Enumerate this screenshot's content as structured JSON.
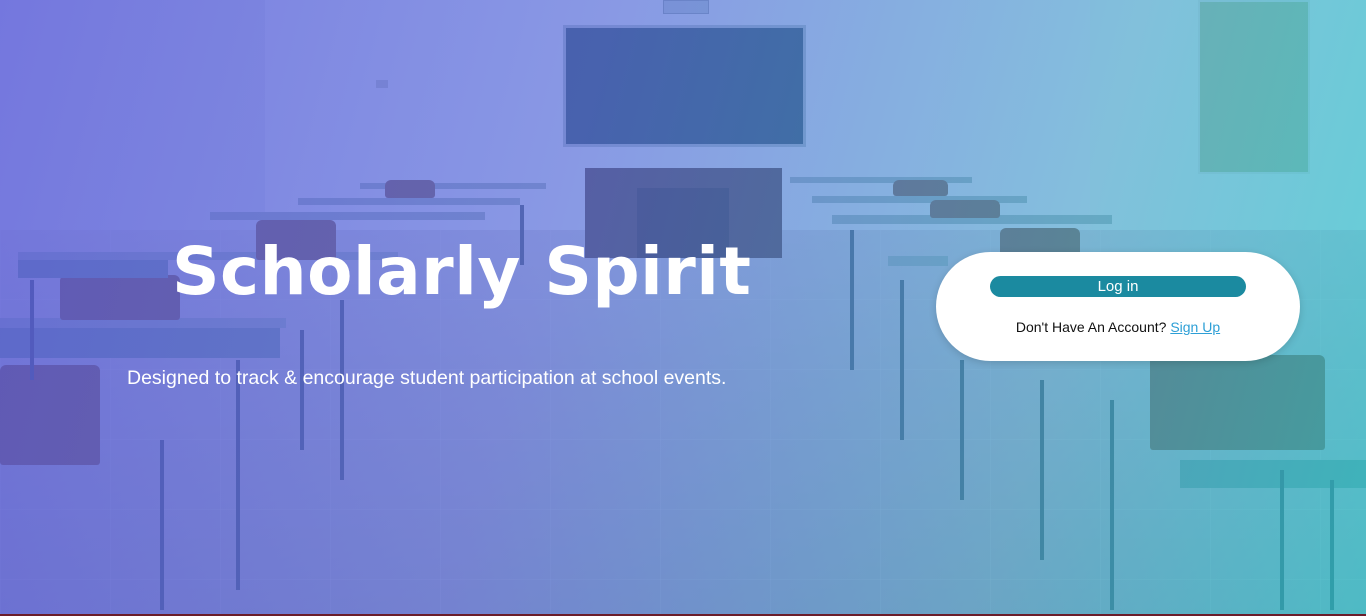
{
  "hero": {
    "title": "Scholarly Spirit",
    "subtitle": "Designed to track & encourage student participation at school events."
  },
  "login_card": {
    "login_label": "Log in",
    "prompt": "Don't Have An Account?",
    "signup_label": "Sign Up"
  },
  "colors": {
    "login_button": "#1b8aa0",
    "signup_link": "#2d9fd6",
    "overlay_left": "#585cdc",
    "overlay_right": "#28c6ce"
  }
}
